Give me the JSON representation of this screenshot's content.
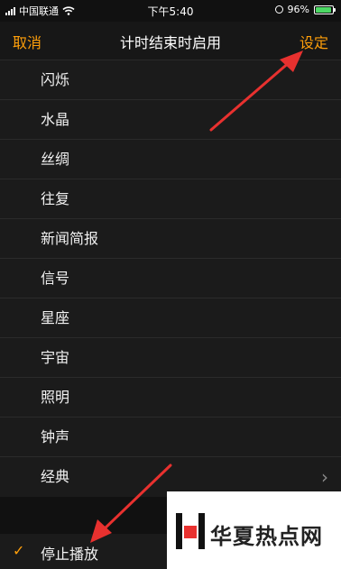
{
  "status_bar": {
    "carrier": "中国联通",
    "time": "下午5:40",
    "battery_percent": "96%",
    "battery_level": 0.96,
    "icons": [
      "signal-icon",
      "wifi-icon",
      "orientation-lock-icon",
      "battery-icon"
    ]
  },
  "nav": {
    "cancel": "取消",
    "title": "计时结束时启用",
    "set": "设定"
  },
  "items": [
    {
      "label": "闪烁"
    },
    {
      "label": "水晶"
    },
    {
      "label": "丝绸"
    },
    {
      "label": "往复"
    },
    {
      "label": "新闻简报"
    },
    {
      "label": "信号"
    },
    {
      "label": "星座"
    },
    {
      "label": "宇宙"
    },
    {
      "label": "照明"
    },
    {
      "label": "钟声"
    },
    {
      "label": "经典",
      "has_chevron": true
    }
  ],
  "stop": {
    "check": "✓",
    "label": "停止播放",
    "selected": true
  },
  "watermark": {
    "text": "华夏热点网"
  },
  "colors": {
    "accent": "#ff9f0a",
    "annotation": "#e8312f",
    "background": "#111111",
    "cell": "#1b1b1b"
  }
}
